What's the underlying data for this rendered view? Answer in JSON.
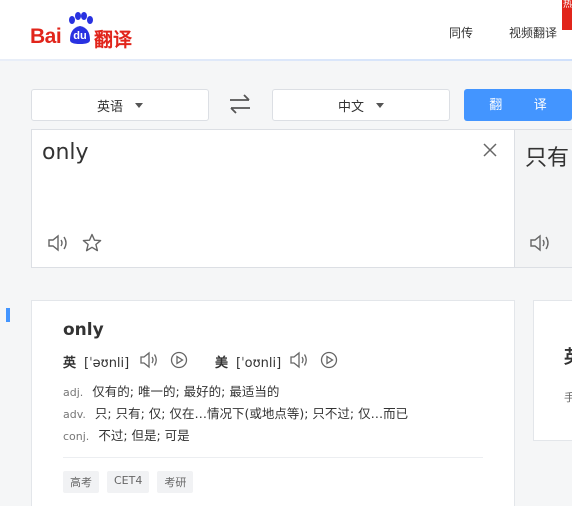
{
  "header": {
    "logo_bai": "Bai",
    "logo_du": "du",
    "logo_fanyi": "翻译",
    "nav": [
      "同传",
      "视频翻译"
    ],
    "nav_hot": "热"
  },
  "toolbar": {
    "source_lang": "英语",
    "target_lang": "中文",
    "translate_label": "翻 译"
  },
  "source": {
    "text": "only"
  },
  "target": {
    "text": "只有"
  },
  "dictionary": {
    "word": "only",
    "phonetics": [
      {
        "region": "英",
        "ipa": "[ˈəʊnli]"
      },
      {
        "region": "美",
        "ipa": "[ˈoʊnli]"
      }
    ],
    "definitions": [
      {
        "pos": "adj.",
        "meaning": "仅有的;  唯一的;  最好的;  最适当的"
      },
      {
        "pos": "adv.",
        "meaning": "只;  只有;  仅;  仅在…情况下(或地点等);  只不过;  仅…而已"
      },
      {
        "pos": "conj.",
        "meaning": "不过;  但是;  可是"
      }
    ],
    "tags": [
      "高考",
      "CET4",
      "考研"
    ]
  },
  "right_card": {
    "big": "英",
    "small": "手"
  },
  "colors": {
    "brand_red": "#e1251b",
    "brand_blue": "#4395ff"
  }
}
